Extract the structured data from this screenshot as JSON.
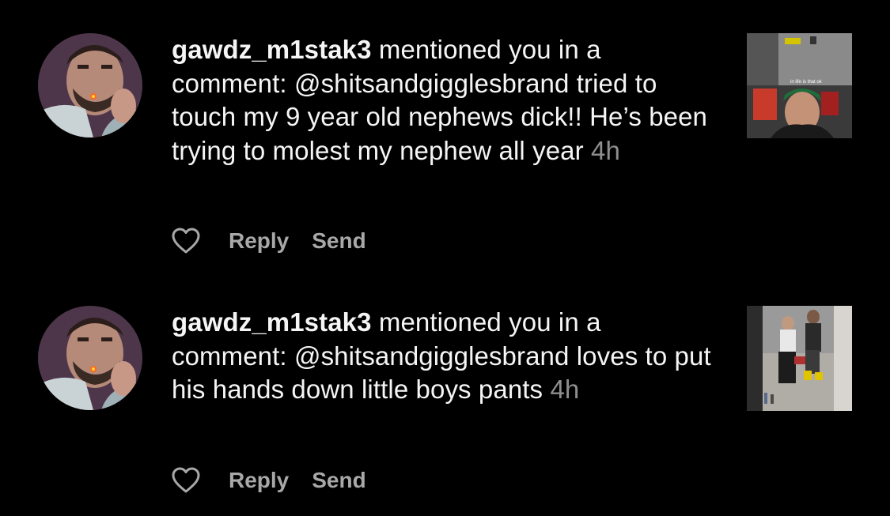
{
  "theme": {
    "background": "#000000",
    "text": "#f5f5f5",
    "muted": "#8e8e8e",
    "action": "#a8a8a8"
  },
  "notifications": [
    {
      "avatar_icon": "profile-avatar",
      "username": "gawdz_m1stak3",
      "action_text": "mentioned you in a comment:",
      "mention": "@shitsandgigglesbrand",
      "comment": "tried to touch my 9 year old nephews dick!! He’s been trying to molest my nephew all year",
      "time": "4h",
      "like_icon": "heart-icon",
      "reply_label": "Reply",
      "send_label": "Send",
      "thumbnail_caption": "in life is that ok"
    },
    {
      "avatar_icon": "profile-avatar",
      "username": "gawdz_m1stak3",
      "action_text": "mentioned you in a comment:",
      "mention": "@shitsandgigglesbrand",
      "comment": "loves to put his hands down little boys pants",
      "time": "4h",
      "like_icon": "heart-icon",
      "reply_label": "Reply",
      "send_label": "Send"
    }
  ]
}
